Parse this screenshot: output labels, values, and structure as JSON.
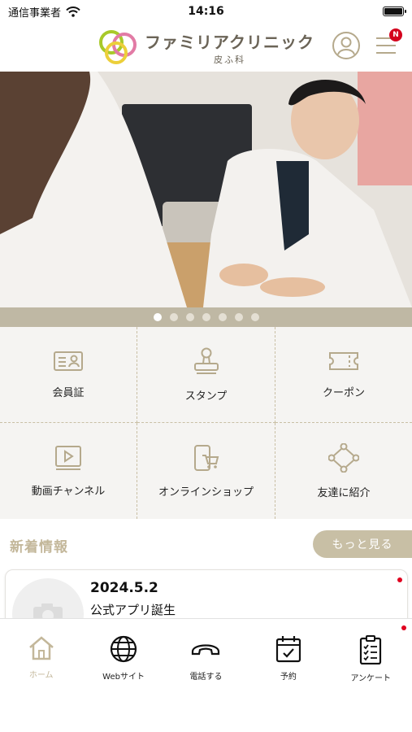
{
  "status": {
    "carrier": "通信事業者",
    "time": "14:16"
  },
  "header": {
    "clinic_name": "ファミリアクリニック",
    "clinic_sub": "皮ふ科",
    "notification_badge": "N"
  },
  "carousel": {
    "slide_count": 7,
    "active_index": 0
  },
  "menu": [
    {
      "label": "会員証",
      "icon": "member-card-icon"
    },
    {
      "label": "スタンプ",
      "icon": "stamp-icon"
    },
    {
      "label": "クーポン",
      "icon": "coupon-icon"
    },
    {
      "label": "動画チャンネル",
      "icon": "video-channel-icon"
    },
    {
      "label": "オンラインショップ",
      "icon": "online-shop-icon"
    },
    {
      "label": "友達に紹介",
      "icon": "share-icon"
    }
  ],
  "news": {
    "title": "新着情報",
    "more_label": "もっと見る",
    "items": [
      {
        "date": "2024.5.2",
        "text": "公式アプリ誕生"
      }
    ]
  },
  "tabbar": [
    {
      "label": "ホーム",
      "icon": "home-icon",
      "active": true
    },
    {
      "label": "Webサイト",
      "icon": "globe-icon",
      "active": false
    },
    {
      "label": "電話する",
      "icon": "phone-icon",
      "active": false
    },
    {
      "label": "予約",
      "icon": "calendar-icon",
      "active": false
    },
    {
      "label": "アンケート",
      "icon": "survey-icon",
      "active": false
    }
  ],
  "colors": {
    "accent": "#c3b79a",
    "button": "#c8bfa5",
    "dots_bar": "#bfb8a4",
    "badge": "#d4001d",
    "icon_stroke": "#b5a98c"
  }
}
